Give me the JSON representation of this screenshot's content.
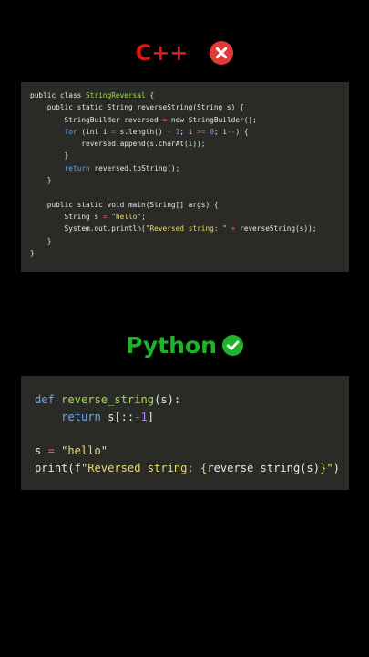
{
  "colors": {
    "cpp_heading": "#e01414",
    "python_heading": "#1fb22a",
    "fail_badge": "#e03a3a",
    "ok_badge": "#1fb22a",
    "code_background": "#2a2b27",
    "plain_text": "#e8e8e0",
    "keyword": "#6ea7e8",
    "class_name": "#a6da4c",
    "string": "#e6da6e",
    "number": "#ae85f0",
    "operator": "#ff5a5a"
  },
  "cpp_section": {
    "title": "C++",
    "badge_icon": "x-circle-icon"
  },
  "python_section": {
    "title": "Python",
    "badge_icon": "check-circle-icon"
  },
  "java_code": {
    "lines": [
      [
        [
          "plain",
          "public class "
        ],
        [
          "cls",
          "StringReversal"
        ],
        [
          "plain",
          " {"
        ]
      ],
      [
        [
          "plain",
          "    public static String reverseString(String s) {"
        ]
      ],
      [
        [
          "plain",
          "        StringBuilder reversed "
        ],
        [
          "op",
          "="
        ],
        [
          "plain",
          " new StringBuilder();"
        ]
      ],
      [
        [
          "plain",
          "        "
        ],
        [
          "kw",
          "for"
        ],
        [
          "plain",
          " (int i "
        ],
        [
          "op",
          "="
        ],
        [
          "plain",
          " s.length() "
        ],
        [
          "op",
          "-"
        ],
        [
          "plain",
          " "
        ],
        [
          "num",
          "1"
        ],
        [
          "plain",
          "; i "
        ],
        [
          "op",
          ">="
        ],
        [
          "plain",
          " "
        ],
        [
          "num",
          "0"
        ],
        [
          "plain",
          "; i"
        ],
        [
          "op",
          "--"
        ],
        [
          "plain",
          ") {"
        ]
      ],
      [
        [
          "plain",
          "            reversed.append(s.charAt(i));"
        ]
      ],
      [
        [
          "plain",
          "        }"
        ]
      ],
      [
        [
          "plain",
          "        "
        ],
        [
          "kw",
          "return"
        ],
        [
          "plain",
          " reversed.toString();"
        ]
      ],
      [
        [
          "plain",
          "    }"
        ]
      ],
      [
        [
          "plain",
          ""
        ]
      ],
      [
        [
          "plain",
          "    public static void main(String[] args) {"
        ]
      ],
      [
        [
          "plain",
          "        String s "
        ],
        [
          "op",
          "="
        ],
        [
          "plain",
          " "
        ],
        [
          "str",
          "\"hello\""
        ],
        [
          "plain",
          ";"
        ]
      ],
      [
        [
          "plain",
          "        System.out.println("
        ],
        [
          "str",
          "\"Reversed string: \""
        ],
        [
          "plain",
          " "
        ],
        [
          "op",
          "+"
        ],
        [
          "plain",
          " reverseString(s));"
        ]
      ],
      [
        [
          "plain",
          "    }"
        ]
      ],
      [
        [
          "plain",
          "}"
        ]
      ]
    ]
  },
  "python_code": {
    "lines": [
      [
        [
          "kw",
          "def"
        ],
        [
          "plain",
          " "
        ],
        [
          "fn",
          "reverse_string"
        ],
        [
          "plain",
          "(s):"
        ]
      ],
      [
        [
          "plain",
          "    "
        ],
        [
          "kw",
          "return"
        ],
        [
          "plain",
          " s[::"
        ],
        [
          "op",
          "-"
        ],
        [
          "num",
          "1"
        ],
        [
          "plain",
          "]"
        ]
      ],
      [
        [
          "plain",
          ""
        ]
      ],
      [
        [
          "plain",
          "s "
        ],
        [
          "op",
          "="
        ],
        [
          "plain",
          " "
        ],
        [
          "str",
          "\"hello\""
        ]
      ],
      [
        [
          "plain",
          "print(f"
        ],
        [
          "str",
          "\"Reversed string: {"
        ],
        [
          "plain",
          "reverse_string(s)"
        ],
        [
          "str",
          "}\""
        ],
        [
          "plain",
          ")"
        ]
      ]
    ]
  }
}
